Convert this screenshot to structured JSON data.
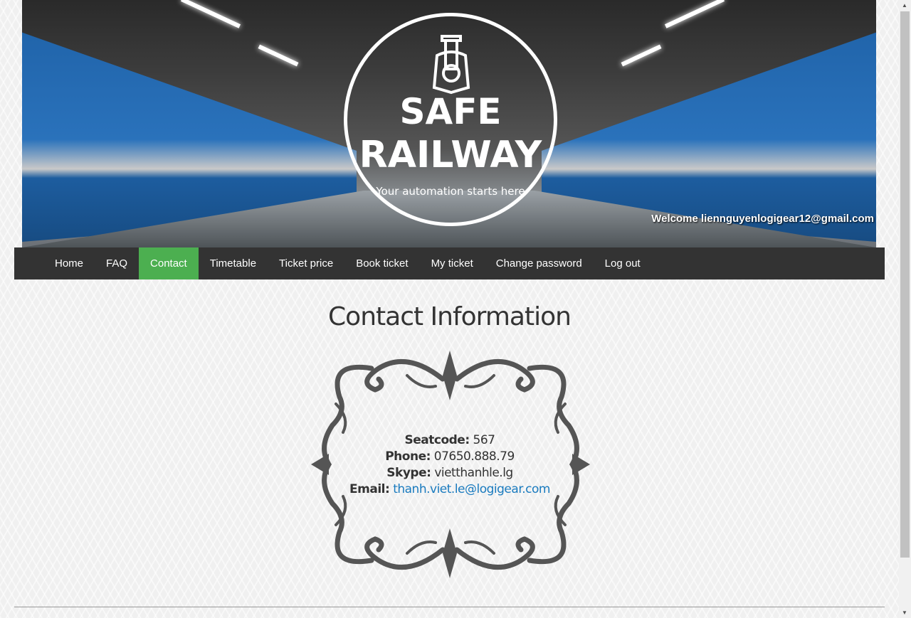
{
  "header": {
    "logo_line1": "SAFE",
    "logo_line2": "RAILWAY",
    "tagline": "Your automation starts here",
    "welcome": "Welcome liennguyenlogigear12@gmail.com"
  },
  "nav": [
    {
      "label": "Home"
    },
    {
      "label": "FAQ"
    },
    {
      "label": "Contact",
      "active": true
    },
    {
      "label": "Timetable"
    },
    {
      "label": "Ticket price"
    },
    {
      "label": "Book ticket"
    },
    {
      "label": "My ticket"
    },
    {
      "label": "Change password"
    },
    {
      "label": "Log out"
    }
  ],
  "main": {
    "title": "Contact Information",
    "seatcode_label": "Seatcode:",
    "seatcode": "567",
    "phone_label": "Phone:",
    "phone": "07650.888.79",
    "skype_label": "Skype:",
    "skype": "vietthanhle.lg",
    "email_label": "Email:",
    "email": "thanh.viet.le@logigear.com"
  },
  "colors": {
    "nav_bg": "#333333",
    "active": "#4caf50",
    "link": "#1a7bbf"
  }
}
